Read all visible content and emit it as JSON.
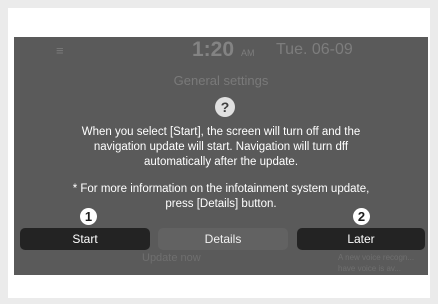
{
  "status": {
    "menu_icon": "≡",
    "time": "1:20",
    "ampm": "AM",
    "date": "Tue. 06-09"
  },
  "background": {
    "title": "General settings",
    "update_now": "Update now",
    "voice_note": "A new voice recogn... have voice is av..."
  },
  "dialog": {
    "help_icon": "?",
    "message_lines": [
      "When you select [Start], the screen will turn off and the",
      "navigation update will start. Navigation will turn dff",
      "automatically after the update."
    ],
    "note_lines": [
      "* For more information on the infotainment system update,",
      "press [Details] button."
    ]
  },
  "buttons": {
    "start": "Start",
    "details": "Details",
    "later": "Later"
  },
  "callouts": {
    "one": "1",
    "two": "2"
  },
  "colors": {
    "screen_bg": "#5a5a5a",
    "button_dark": "#232323",
    "button_mid": "#626262"
  }
}
